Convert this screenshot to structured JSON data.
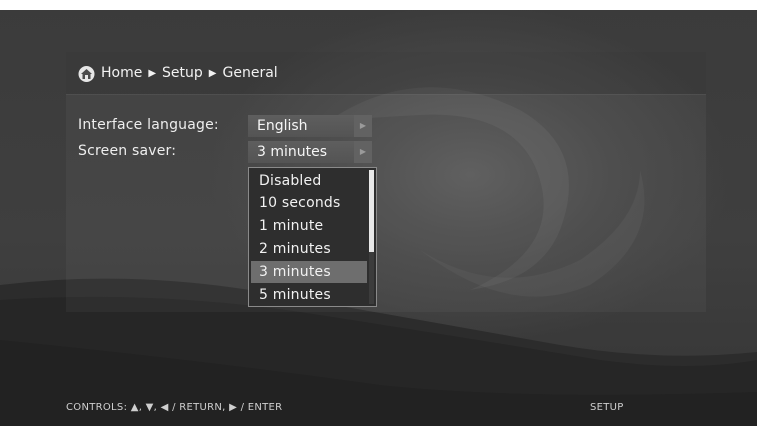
{
  "breadcrumb": {
    "home": "Home",
    "setup": "Setup",
    "general": "General",
    "separator": "▶"
  },
  "settings": [
    {
      "label": "Interface language:",
      "value": "English"
    },
    {
      "label": "Screen saver:",
      "value": "3 minutes"
    }
  ],
  "dropdown": {
    "options": [
      "Disabled",
      "10 seconds",
      "1 minute",
      "2 minutes",
      "3 minutes",
      "5 minutes"
    ],
    "selected_index": 4,
    "scroll_fraction_visible": 0.6
  },
  "arrow_glyph": "▶",
  "footer": {
    "controls": "CONTROLS:  ▲, ▼, ◀ / RETURN, ▶ / ENTER",
    "section": "SETUP"
  },
  "colors": {
    "background": "#3a3a3a",
    "selected_option": "#6e6e6e",
    "field": "#5a5a5a"
  }
}
